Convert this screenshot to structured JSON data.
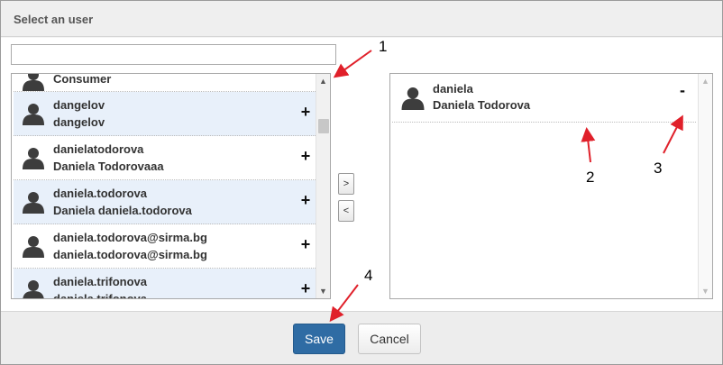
{
  "dialog": {
    "title": "Select an user"
  },
  "search": {
    "value": "",
    "placeholder": ""
  },
  "available_users": [
    {
      "line1": "Consumer",
      "line2": "",
      "action": "+"
    },
    {
      "line1": "dangelov",
      "line2": "dangelov",
      "action": "+"
    },
    {
      "line1": "danielatodorova",
      "line2": "Daniela Todorovaaa",
      "action": "+"
    },
    {
      "line1": "daniela.todorova",
      "line2": "Daniela daniela.todorova",
      "action": "+"
    },
    {
      "line1": "daniela.todorova@sirma.bg",
      "line2": "daniela.todorova@sirma.bg",
      "action": "+"
    },
    {
      "line1": "daniela.trifonova",
      "line2": "daniela.trifonova",
      "action": "+"
    }
  ],
  "selected_users": [
    {
      "line1": "daniela",
      "line2": "Daniela Todorova",
      "action": "-"
    }
  ],
  "move_buttons": {
    "add": ">",
    "remove": "<"
  },
  "scroll_arrows": {
    "up": "▲",
    "down": "▼"
  },
  "footer": {
    "save_label": "Save",
    "cancel_label": "Cancel"
  },
  "annotations": [
    "1",
    "2",
    "3",
    "4"
  ],
  "colors": {
    "accent": "#2f6ca4",
    "item_highlight": "#e8f0fa",
    "annotation_arrow": "#e0202a"
  },
  "icons": {
    "avatar": "user-silhouette-icon",
    "add": "plus-icon",
    "remove": "minus-icon"
  }
}
